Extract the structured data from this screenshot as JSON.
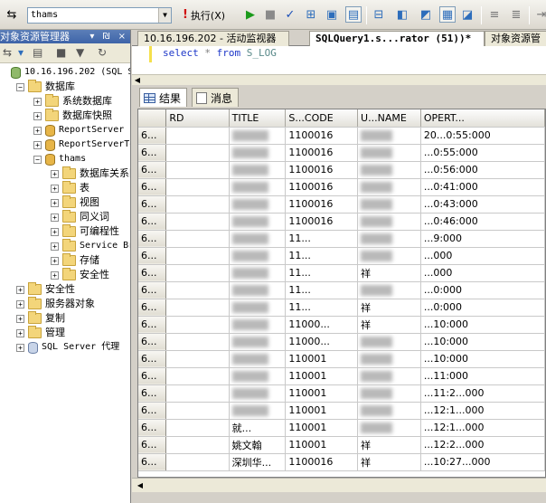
{
  "toolbar": {
    "database": "thams",
    "execute_label": "执行(X)",
    "icons": [
      "connect-icon",
      "execute-icon",
      "debug-icon",
      "stop-icon",
      "parse-icon",
      "plan-icon",
      "results-grid-icon",
      "comment-icon"
    ]
  },
  "object_explorer": {
    "title": "对象资源管理器",
    "header_buttons": "▾ ₪ ×",
    "tree": [
      {
        "label": "10.16.196.202 (SQL Se",
        "level": 0,
        "icon": "server",
        "expander": "",
        "mono": true
      },
      {
        "label": "数据库",
        "level": 1,
        "icon": "folder",
        "expander": "−"
      },
      {
        "label": "系统数据库",
        "level": 2,
        "icon": "folder",
        "expander": "+"
      },
      {
        "label": "数据库快照",
        "level": 2,
        "icon": "folder",
        "expander": "+"
      },
      {
        "label": "ReportServer",
        "level": 2,
        "icon": "db",
        "expander": "+",
        "mono": true
      },
      {
        "label": "ReportServerTem",
        "level": 2,
        "icon": "db",
        "expander": "+",
        "mono": true
      },
      {
        "label": "thams",
        "level": 2,
        "icon": "db",
        "expander": "−",
        "mono": true
      },
      {
        "label": "数据库关系图",
        "level": 3,
        "icon": "folder",
        "expander": "+"
      },
      {
        "label": "表",
        "level": 3,
        "icon": "folder",
        "expander": "+"
      },
      {
        "label": "视图",
        "level": 3,
        "icon": "folder",
        "expander": "+"
      },
      {
        "label": "同义词",
        "level": 3,
        "icon": "folder",
        "expander": "+"
      },
      {
        "label": "可编程性",
        "level": 3,
        "icon": "folder",
        "expander": "+"
      },
      {
        "label": "Service Brol",
        "level": 3,
        "icon": "folder",
        "expander": "+",
        "mono": true
      },
      {
        "label": "存储",
        "level": 3,
        "icon": "folder",
        "expander": "+"
      },
      {
        "label": "安全性",
        "level": 3,
        "icon": "folder",
        "expander": "+"
      },
      {
        "label": "安全性",
        "level": 1,
        "icon": "folder",
        "expander": "+"
      },
      {
        "label": "服务器对象",
        "level": 1,
        "icon": "folder",
        "expander": "+"
      },
      {
        "label": "复制",
        "level": 1,
        "icon": "folder",
        "expander": "+"
      },
      {
        "label": "管理",
        "level": 1,
        "icon": "folder",
        "expander": "+"
      },
      {
        "label": "SQL Server 代理",
        "level": 1,
        "icon": "agent",
        "expander": "+",
        "mono": true
      }
    ]
  },
  "tabs": [
    {
      "label": "10.16.196.202 - 活动监视器",
      "active": false
    },
    {
      "label": "SQLQuery1.s...rator (51))*",
      "active": true
    },
    {
      "label": "对象资源管",
      "active": false
    }
  ],
  "editor": {
    "kw_select": "select",
    "star": "*",
    "kw_from": "from",
    "table": "S_LOG"
  },
  "result_tabs": {
    "results": "结果",
    "messages": "消息"
  },
  "grid": {
    "columns": [
      "",
      "RD",
      "TITLE",
      "S...CODE",
      "U...NAME",
      "OPERT..."
    ],
    "rows": [
      [
        "6...",
        "",
        "",
        "1100016",
        "",
        "20...0:55:000"
      ],
      [
        "6...",
        "",
        "",
        "1100016",
        "",
        "...0:55:000"
      ],
      [
        "6...",
        "",
        "",
        "1100016",
        "",
        "...0:56:000"
      ],
      [
        "6...",
        "",
        "",
        "1100016",
        "",
        "...0:41:000"
      ],
      [
        "6...",
        "",
        "",
        "1100016",
        "",
        "...0:43:000"
      ],
      [
        "6...",
        "",
        "",
        "1100016",
        "",
        "...0:46:000"
      ],
      [
        "6...",
        "",
        "",
        "11...",
        "",
        "...9:000"
      ],
      [
        "6...",
        "",
        "",
        "11...",
        "",
        "...000"
      ],
      [
        "6...",
        "",
        "",
        "11...",
        "祥",
        "...000"
      ],
      [
        "6...",
        "",
        "",
        "11...",
        "",
        "...0:000"
      ],
      [
        "6...",
        "",
        "",
        "11...",
        "祥",
        "...0:000"
      ],
      [
        "6...",
        "",
        "",
        "11000...",
        "祥",
        "...10:000"
      ],
      [
        "6...",
        "",
        "",
        "11000...",
        "",
        "...10:000"
      ],
      [
        "6...",
        "",
        "",
        "110001",
        "",
        "...10:000"
      ],
      [
        "6...",
        "",
        "",
        "110001",
        "",
        "...11:000"
      ],
      [
        "6...",
        "",
        "",
        "110001",
        "",
        "...11:2...000"
      ],
      [
        "6...",
        "",
        "",
        "110001",
        "",
        "...12:1...000"
      ],
      [
        "6...",
        "",
        "就...",
        "110001",
        "",
        "...12:1...000"
      ],
      [
        "6...",
        "",
        "姚文翰",
        "110001",
        "祥",
        "...12:2...000"
      ],
      [
        "6...",
        "",
        "深圳华...",
        "1100016",
        "祥",
        "...10:27...000"
      ]
    ]
  }
}
